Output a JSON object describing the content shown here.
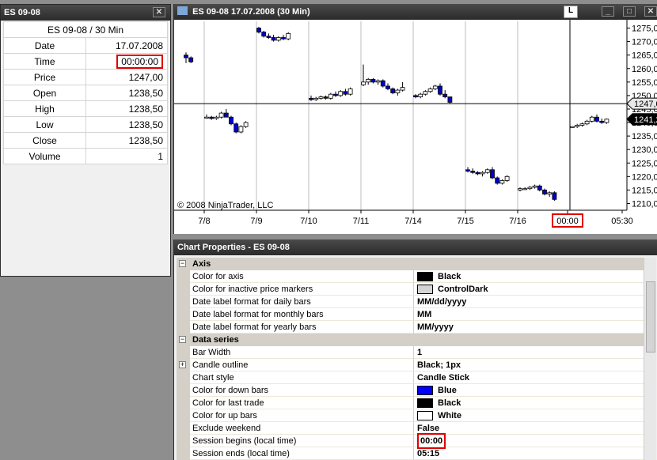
{
  "data_window": {
    "title": "ES 09-08",
    "close_glyph": "✕",
    "header": "ES 09-08 / 30 Min",
    "rows": [
      {
        "label": "Date",
        "value": "17.07.2008"
      },
      {
        "label": "Time",
        "value": "00:00:00"
      },
      {
        "label": "Price",
        "value": "1247,00"
      },
      {
        "label": "Open",
        "value": "1238,50"
      },
      {
        "label": "High",
        "value": "1238,50"
      },
      {
        "label": "Low",
        "value": "1238,50"
      },
      {
        "label": "Close",
        "value": "1238,50"
      },
      {
        "label": "Volume",
        "value": "1"
      }
    ]
  },
  "chart_window": {
    "title": "ES 09-08  17.07.2008 (30 Min)",
    "link_label": "L",
    "copyright": "© 2008 NinjaTrader, LLC",
    "buttons": [
      "_",
      "□",
      "✕"
    ]
  },
  "chart_data": {
    "type": "candlestick",
    "colors": {
      "up": "#ffffff",
      "down": "#0000cc",
      "outline": "#000000",
      "axis": "#000000",
      "gridline": "#c8c8c8"
    },
    "ylim": [
      1207.5,
      1277.5
    ],
    "y_ticks": [
      "1275,00",
      "1270,00",
      "1265,00",
      "1260,00",
      "1255,00",
      "1250,00",
      "1245,00",
      "1240,00",
      "1235,00",
      "1230,00",
      "1225,00",
      "1220,00",
      "1215,00",
      "1210,00"
    ],
    "x_labels": [
      "7/8",
      "7/9",
      "7/10",
      "7/11",
      "7/14",
      "7/15",
      "7/16",
      "00:00",
      "05:30"
    ],
    "price_markers": [
      {
        "label": "1247,00",
        "value": 1247.0,
        "style": "inactive"
      },
      {
        "label": "1241,25",
        "value": 1241.25,
        "style": "last"
      }
    ],
    "crosshair_price": 1247.0,
    "candles": [
      [
        1265,
        1266,
        1262,
        1264
      ],
      [
        1264,
        1264.5,
        1262,
        1262.5
      ],
      [
        1242,
        1243,
        1241.5,
        1242
      ],
      [
        1242,
        1242.5,
        1241,
        1241.5
      ],
      [
        1241.5,
        1242.5,
        1241,
        1242
      ],
      [
        1242,
        1244,
        1241.5,
        1243.5
      ],
      [
        1243.5,
        1245,
        1242.5,
        1242
      ],
      [
        1242,
        1242.5,
        1239,
        1239.5
      ],
      [
        1239.5,
        1240,
        1236,
        1236.5
      ],
      [
        1236.5,
        1239,
        1236,
        1238.5
      ],
      [
        1238.5,
        1240.5,
        1238,
        1240
      ],
      [
        1275,
        1275.5,
        1273,
        1273.5
      ],
      [
        1273.5,
        1274,
        1271.5,
        1272
      ],
      [
        1272,
        1273,
        1271,
        1271.5
      ],
      [
        1271.5,
        1272.5,
        1270,
        1270.5
      ],
      [
        1270.5,
        1272,
        1270,
        1271.5
      ],
      [
        1271.5,
        1272.5,
        1270.5,
        1271
      ],
      [
        1271,
        1273.5,
        1270.5,
        1273
      ],
      [
        1249,
        1250,
        1248,
        1248.5
      ],
      [
        1248.5,
        1249.5,
        1248,
        1249
      ],
      [
        1249,
        1250,
        1248.5,
        1249.5
      ],
      [
        1249.5,
        1250,
        1248.5,
        1249
      ],
      [
        1249,
        1251,
        1248.5,
        1250.5
      ],
      [
        1250.5,
        1251.5,
        1249.5,
        1250
      ],
      [
        1250,
        1252,
        1249.5,
        1251.5
      ],
      [
        1251.5,
        1252.5,
        1250,
        1250.5
      ],
      [
        1250.5,
        1253,
        1250,
        1252.5
      ],
      [
        1254,
        1261.5,
        1253.5,
        1255
      ],
      [
        1255,
        1256.5,
        1254,
        1256
      ],
      [
        1256,
        1256.5,
        1254.5,
        1255
      ],
      [
        1255,
        1256,
        1254,
        1255.5
      ],
      [
        1255.5,
        1256,
        1253,
        1253.5
      ],
      [
        1253.5,
        1254.5,
        1252,
        1252.5
      ],
      [
        1252.5,
        1253,
        1250.5,
        1251
      ],
      [
        1251,
        1252.5,
        1250,
        1252
      ],
      [
        1252,
        1255,
        1251.5,
        1253
      ],
      [
        1250,
        1250.5,
        1249,
        1249.5
      ],
      [
        1249.5,
        1251,
        1249,
        1250.5
      ],
      [
        1250.5,
        1252,
        1250,
        1251.5
      ],
      [
        1251.5,
        1253,
        1251,
        1252.5
      ],
      [
        1252.5,
        1254,
        1252,
        1253.5
      ],
      [
        1253.5,
        1254.5,
        1250,
        1250.5
      ],
      [
        1250.5,
        1252,
        1249,
        1249.5
      ],
      [
        1249.5,
        1249.5,
        1247,
        1247.5
      ],
      [
        1222.5,
        1223.5,
        1221.5,
        1222
      ],
      [
        1222,
        1223,
        1221,
        1221.5
      ],
      [
        1221.5,
        1222,
        1220.5,
        1221
      ],
      [
        1221,
        1222,
        1220,
        1221.5
      ],
      [
        1221.5,
        1223,
        1221,
        1222.5
      ],
      [
        1222.5,
        1223.5,
        1219,
        1219.5
      ],
      [
        1219.5,
        1220,
        1217,
        1217.5
      ],
      [
        1217.5,
        1219,
        1217,
        1218.5
      ],
      [
        1218.5,
        1220.5,
        1218,
        1220
      ],
      [
        1215,
        1216,
        1214.5,
        1215.5
      ],
      [
        1215.5,
        1216,
        1215,
        1215.5
      ],
      [
        1215.5,
        1216.5,
        1215,
        1216
      ],
      [
        1216,
        1217,
        1215.5,
        1216.5
      ],
      [
        1216.5,
        1217,
        1214.5,
        1215
      ],
      [
        1215,
        1215.5,
        1213,
        1213.5
      ],
      [
        1213.5,
        1214.5,
        1212.5,
        1214
      ],
      [
        1214,
        1214.5,
        1211,
        1211.5
      ],
      [
        1238.5,
        1238.5,
        1238.5,
        1238.5
      ],
      [
        1238.5,
        1239.5,
        1238,
        1239
      ],
      [
        1239,
        1240,
        1238.5,
        1239.5
      ],
      [
        1239.5,
        1241,
        1239,
        1240.5
      ],
      [
        1240.5,
        1242.5,
        1240,
        1242
      ],
      [
        1242,
        1243,
        1240,
        1240.5
      ],
      [
        1240.5,
        1241.5,
        1239.5,
        1240
      ],
      [
        1240,
        1241.5,
        1239.5,
        1241.25
      ]
    ]
  },
  "properties_window": {
    "title": "Chart Properties - ES 09-08",
    "rows": [
      {
        "type": "category",
        "name": "Axis",
        "expander": "−"
      },
      {
        "type": "prop",
        "name": "Color for axis",
        "value": "Black",
        "swatch": "#000000"
      },
      {
        "type": "prop",
        "name": "Color for inactive price markers",
        "value": "ControlDark",
        "swatch": "#d4d4d4"
      },
      {
        "type": "prop",
        "name": "Date label format for daily bars",
        "value": "MM/dd/yyyy"
      },
      {
        "type": "prop",
        "name": "Date label format for monthly bars",
        "value": "MM"
      },
      {
        "type": "prop",
        "name": "Date label format for yearly bars",
        "value": "MM/yyyy"
      },
      {
        "type": "category",
        "name": "Data series",
        "expander": "−"
      },
      {
        "type": "prop",
        "name": "Bar Width",
        "value": "1"
      },
      {
        "type": "prop",
        "name": "Candle outline",
        "value": "Black; 1px",
        "expander": "+"
      },
      {
        "type": "prop",
        "name": "Chart style",
        "value": "Candle Stick"
      },
      {
        "type": "prop",
        "name": "Color for down bars",
        "value": "Blue",
        "swatch": "#0000ff"
      },
      {
        "type": "prop",
        "name": "Color for last trade",
        "value": "Black",
        "swatch": "#000000"
      },
      {
        "type": "prop",
        "name": "Color for up bars",
        "value": "White",
        "swatch": "#ffffff"
      },
      {
        "type": "prop",
        "name": "Exclude weekend",
        "value": "False"
      },
      {
        "type": "prop",
        "name": "Session begins (local time)",
        "value": "00:00",
        "highlight": true
      },
      {
        "type": "prop",
        "name": "Session ends (local time)",
        "value": "05:15"
      }
    ]
  }
}
